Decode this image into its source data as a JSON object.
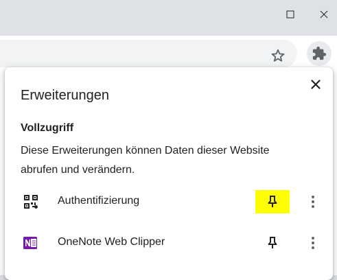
{
  "popup": {
    "title": "Erweiterungen",
    "section_title": "Vollzugriff",
    "section_description": "Diese Erweiterungen können Daten dieser Website abrufen und verändern."
  },
  "extensions": [
    {
      "name": "Authentifizierung",
      "icon": "qr-code-icon",
      "pin_highlighted": true
    },
    {
      "name": "OneNote Web Clipper",
      "icon": "onenote-icon",
      "pin_highlighted": false
    }
  ],
  "colors": {
    "pin_highlight": "#ffff00",
    "onenote_purple": "#7719aa",
    "text": "#202124",
    "icon": "#5f6368"
  }
}
